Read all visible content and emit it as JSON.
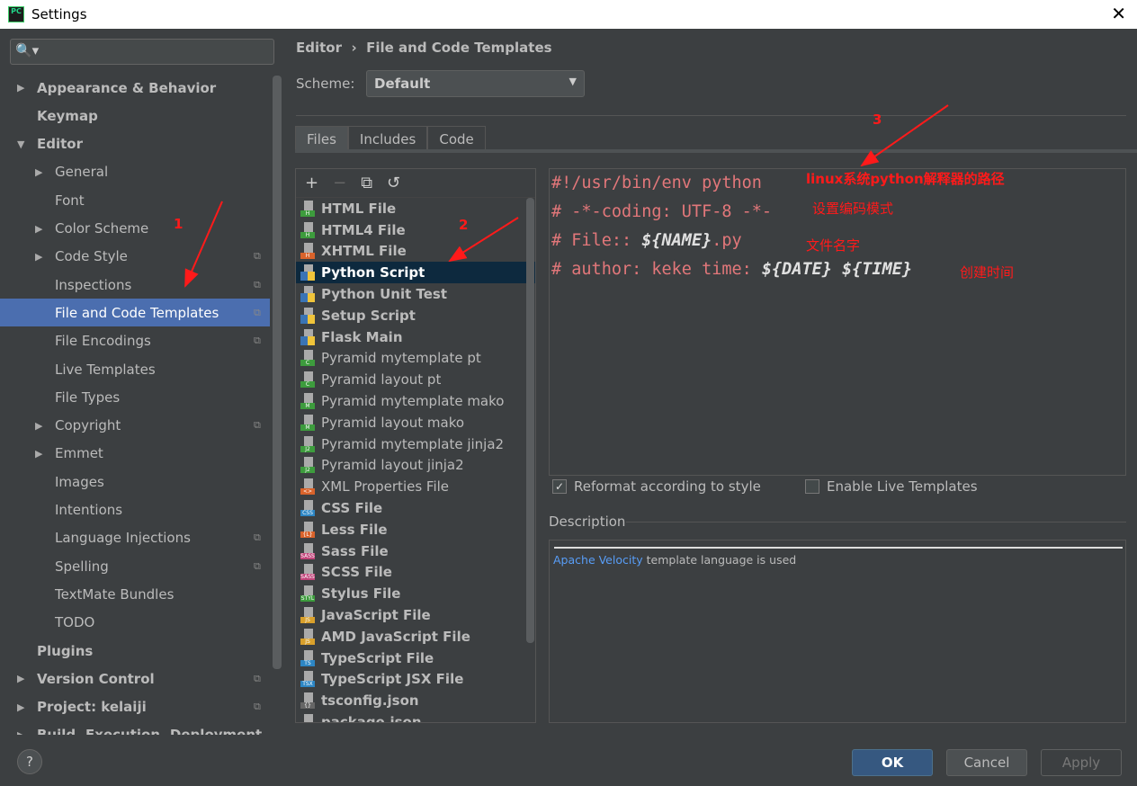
{
  "window": {
    "title": "Settings",
    "close": "✕"
  },
  "search": {
    "icon": "🔍▾"
  },
  "sidebar": [
    {
      "label": "Appearance & Behavior",
      "level": 0,
      "arrow": "▶",
      "bold": true
    },
    {
      "label": "Keymap",
      "level": 0,
      "bold": true
    },
    {
      "label": "Editor",
      "level": 0,
      "arrow": "▼",
      "bold": true
    },
    {
      "label": "General",
      "level": 1,
      "arrow": "▶"
    },
    {
      "label": "Font",
      "level": 1
    },
    {
      "label": "Color Scheme",
      "level": 1,
      "arrow": "▶"
    },
    {
      "label": "Code Style",
      "level": 1,
      "arrow": "▶",
      "copy": true
    },
    {
      "label": "Inspections",
      "level": 1,
      "copy": true
    },
    {
      "label": "File and Code Templates",
      "level": 1,
      "copy": true,
      "selected": true
    },
    {
      "label": "File Encodings",
      "level": 1,
      "copy": true
    },
    {
      "label": "Live Templates",
      "level": 1
    },
    {
      "label": "File Types",
      "level": 1
    },
    {
      "label": "Copyright",
      "level": 1,
      "arrow": "▶",
      "copy": true
    },
    {
      "label": "Emmet",
      "level": 1,
      "arrow": "▶"
    },
    {
      "label": "Images",
      "level": 1
    },
    {
      "label": "Intentions",
      "level": 1
    },
    {
      "label": "Language Injections",
      "level": 1,
      "copy": true
    },
    {
      "label": "Spelling",
      "level": 1,
      "copy": true
    },
    {
      "label": "TextMate Bundles",
      "level": 1
    },
    {
      "label": "TODO",
      "level": 1
    },
    {
      "label": "Plugins",
      "level": 0,
      "bold": true
    },
    {
      "label": "Version Control",
      "level": 0,
      "arrow": "▶",
      "bold": true,
      "copy": true
    },
    {
      "label": "Project: kelaiji",
      "level": 0,
      "arrow": "▶",
      "bold": true,
      "copy": true
    },
    {
      "label": "Build, Execution, Deployment",
      "level": 0,
      "arrow": "▶",
      "bold": true
    }
  ],
  "breadcrumb": {
    "parent": "Editor",
    "sep": "›",
    "current": "File and Code Templates"
  },
  "scheme": {
    "label": "Scheme:",
    "value": "Default"
  },
  "tabs": [
    {
      "label": "Files",
      "active": true
    },
    {
      "label": "Includes"
    },
    {
      "label": "Code"
    }
  ],
  "toolbar": {
    "add": "+",
    "remove": "−",
    "copy": "⧉",
    "reset": "↺"
  },
  "templates": [
    {
      "label": "HTML File",
      "bold": true,
      "badge": "H",
      "color": "#3d9c3d"
    },
    {
      "label": "HTML4 File",
      "bold": true,
      "badge": "H",
      "color": "#3d9c3d"
    },
    {
      "label": "XHTML File",
      "bold": true,
      "badge": "H",
      "color": "#d9632b"
    },
    {
      "label": "Python Script",
      "bold": true,
      "py": true,
      "selected": true
    },
    {
      "label": "Python Unit Test",
      "bold": true,
      "py": true
    },
    {
      "label": "Setup Script",
      "bold": true,
      "py": true
    },
    {
      "label": "Flask Main",
      "bold": true,
      "py": true
    },
    {
      "label": "Pyramid mytemplate pt",
      "badge": "C",
      "color": "#3d9c3d"
    },
    {
      "label": "Pyramid layout pt",
      "badge": "C",
      "color": "#3d9c3d"
    },
    {
      "label": "Pyramid mytemplate mako",
      "badge": "M",
      "color": "#3d9c3d"
    },
    {
      "label": "Pyramid layout mako",
      "badge": "M",
      "color": "#3d9c3d"
    },
    {
      "label": "Pyramid mytemplate jinja2",
      "badge": "J2",
      "color": "#3d9c3d"
    },
    {
      "label": "Pyramid layout jinja2",
      "badge": "J2",
      "color": "#3d9c3d"
    },
    {
      "label": "XML Properties File",
      "badge": "<>",
      "color": "#d9632b"
    },
    {
      "label": "CSS File",
      "bold": true,
      "badge": "CSS",
      "color": "#2d86c4"
    },
    {
      "label": "Less File",
      "bold": true,
      "badge": "{L}",
      "color": "#d9632b"
    },
    {
      "label": "Sass File",
      "bold": true,
      "badge": "SASS",
      "color": "#c2447a"
    },
    {
      "label": "SCSS File",
      "bold": true,
      "badge": "SASS",
      "color": "#c2447a"
    },
    {
      "label": "Stylus File",
      "bold": true,
      "badge": "STYL",
      "color": "#3d9c3d"
    },
    {
      "label": "JavaScript File",
      "bold": true,
      "badge": "JS",
      "color": "#d9a02b"
    },
    {
      "label": "AMD JavaScript File",
      "bold": true,
      "badge": "JS",
      "color": "#d9a02b"
    },
    {
      "label": "TypeScript File",
      "bold": true,
      "badge": "TS",
      "color": "#2d86c4"
    },
    {
      "label": "TypeScript JSX File",
      "bold": true,
      "badge": "TSX",
      "color": "#2d86c4"
    },
    {
      "label": "tsconfig.json",
      "bold": true,
      "badge": "{}",
      "color": "#666"
    },
    {
      "label": "package.json",
      "bold": true,
      "badge": "{}",
      "color": "#666"
    }
  ],
  "editor": {
    "lines": [
      [
        {
          "t": "#!/usr/bin/env python"
        }
      ],
      [
        {
          "t": "# -*-coding: UTF-8 -*-"
        }
      ],
      [
        {
          "t": "# File:: "
        },
        {
          "t": "${NAME}",
          "v": true
        },
        {
          "t": ".py"
        }
      ],
      [
        {
          "t": "# author: keke time: "
        },
        {
          "t": "${DATE}",
          "v": true
        },
        {
          "t": " "
        },
        {
          "t": "${TIME}",
          "v": true
        }
      ]
    ]
  },
  "annotations": {
    "n1": "1",
    "n2": "2",
    "n3": "3",
    "interpreter": "linux系统python解释器的路径",
    "encoding": "设置编码模式",
    "filename": "文件名字",
    "created": "创建时间",
    "color": "#ff1a1a"
  },
  "options": {
    "reformat": "Reformat according to style",
    "reformat_checked": true,
    "live": "Enable Live Templates",
    "live_checked": false
  },
  "description": {
    "label": "Description",
    "link": "Apache Velocity",
    "text": " template language is used"
  },
  "footer": {
    "help": "?",
    "ok": "OK",
    "cancel": "Cancel",
    "apply": "Apply"
  }
}
